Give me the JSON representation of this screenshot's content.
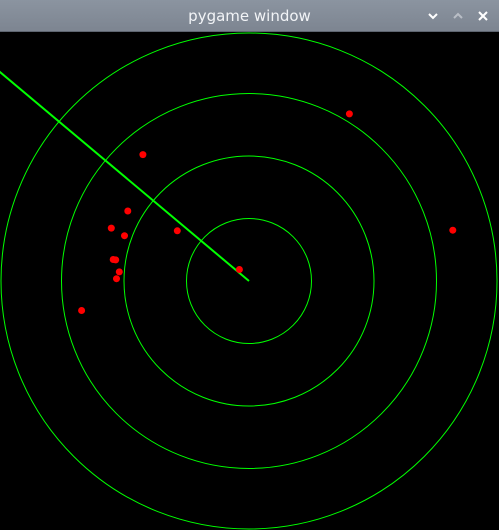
{
  "window": {
    "title": "pygame window",
    "controls": [
      {
        "name": "minimize-button",
        "icon": "chevron-down-icon"
      },
      {
        "name": "maximize-button",
        "icon": "chevron-up-icon"
      },
      {
        "name": "close-button",
        "icon": "close-icon"
      }
    ]
  },
  "radar": {
    "ring_color": "#00ff00",
    "sweep_color": "#00ff00",
    "target_color": "#ff0000",
    "sweep_angle_deg": 140,
    "ring_count": 4,
    "targets": [
      {
        "angle_deg": 130,
        "distance": 0.66
      },
      {
        "angle_deg": 59,
        "distance": 0.78
      },
      {
        "angle_deg": 14,
        "distance": 0.84
      },
      {
        "angle_deg": 130,
        "distance": 0.06
      },
      {
        "angle_deg": 145,
        "distance": 0.35
      },
      {
        "angle_deg": 150,
        "distance": 0.56
      },
      {
        "angle_deg": 159,
        "distance": 0.59
      },
      {
        "angle_deg": 160,
        "distance": 0.53
      },
      {
        "angle_deg": 171,
        "distance": 0.55
      },
      {
        "angle_deg": 171,
        "distance": 0.54
      },
      {
        "angle_deg": 176,
        "distance": 0.52
      },
      {
        "angle_deg": 179,
        "distance": 0.53
      },
      {
        "angle_deg": 190,
        "distance": 0.68
      }
    ]
  }
}
